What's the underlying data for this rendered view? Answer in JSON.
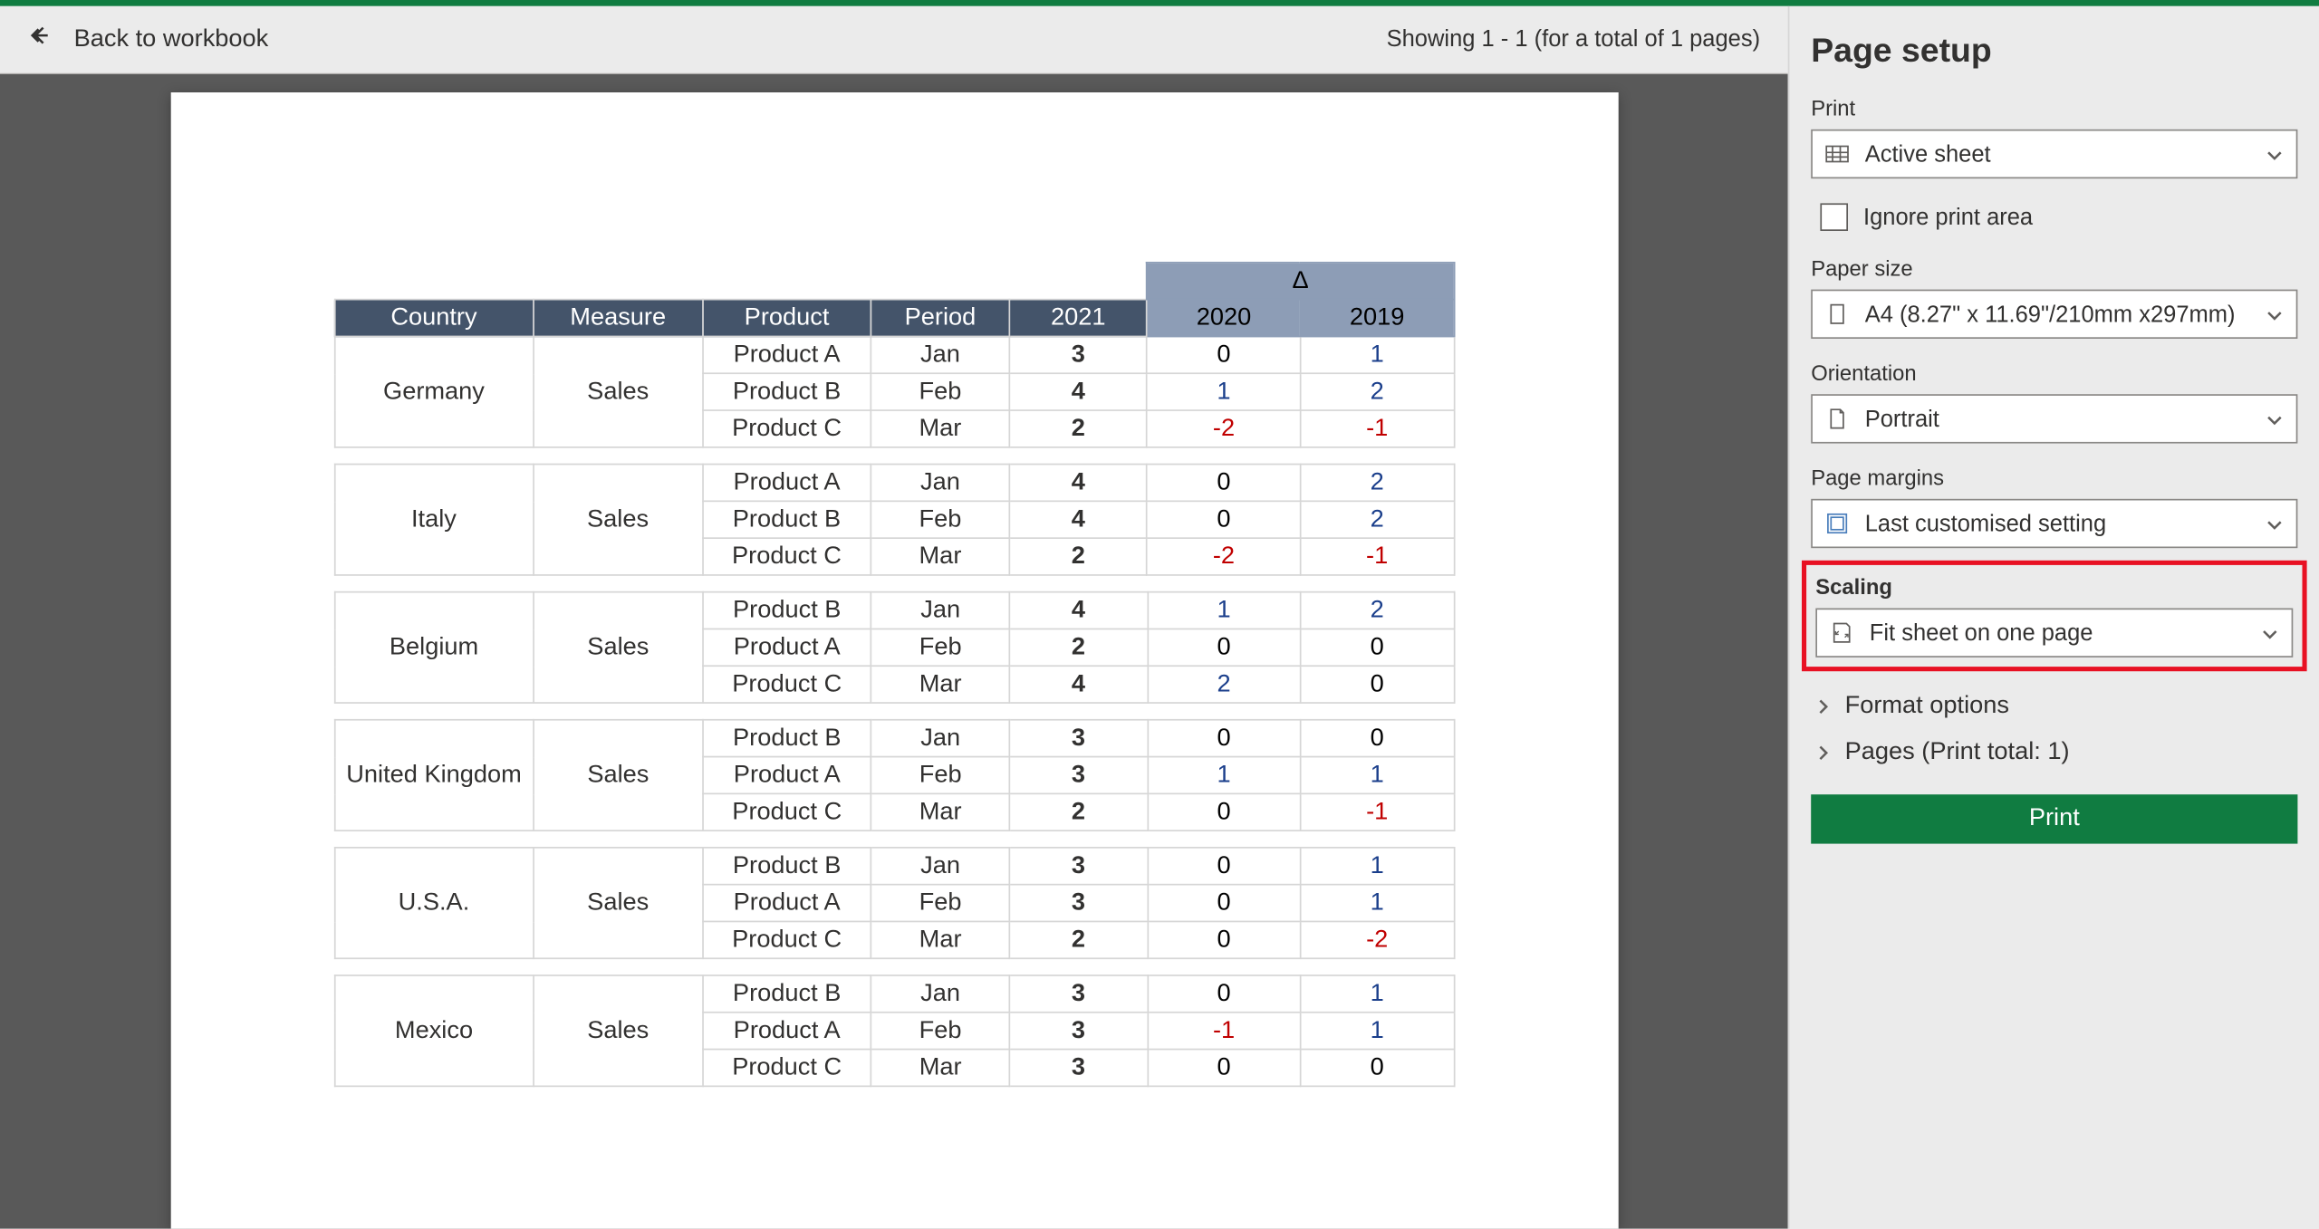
{
  "header": {
    "back_label": "Back to workbook",
    "showing": "Showing 1 - 1 (for a total of 1 pages)"
  },
  "table": {
    "delta_symbol": "Δ",
    "columns": [
      "Country",
      "Measure",
      "Product",
      "Period",
      "2021",
      "2020",
      "2019"
    ],
    "blocks": [
      {
        "country": "Germany",
        "measure": "Sales",
        "rows": [
          {
            "product": "Product A",
            "period": "Jan",
            "v2021": "3",
            "d2020": "0",
            "d2019": "1"
          },
          {
            "product": "Product B",
            "period": "Feb",
            "v2021": "4",
            "d2020": "1",
            "d2019": "2"
          },
          {
            "product": "Product C",
            "period": "Mar",
            "v2021": "2",
            "d2020": "-2",
            "d2019": "-1"
          }
        ]
      },
      {
        "country": "Italy",
        "measure": "Sales",
        "rows": [
          {
            "product": "Product A",
            "period": "Jan",
            "v2021": "4",
            "d2020": "0",
            "d2019": "2"
          },
          {
            "product": "Product B",
            "period": "Feb",
            "v2021": "4",
            "d2020": "0",
            "d2019": "2"
          },
          {
            "product": "Product C",
            "period": "Mar",
            "v2021": "2",
            "d2020": "-2",
            "d2019": "-1"
          }
        ]
      },
      {
        "country": "Belgium",
        "measure": "Sales",
        "rows": [
          {
            "product": "Product B",
            "period": "Jan",
            "v2021": "4",
            "d2020": "1",
            "d2019": "2"
          },
          {
            "product": "Product A",
            "period": "Feb",
            "v2021": "2",
            "d2020": "0",
            "d2019": "0"
          },
          {
            "product": "Product C",
            "period": "Mar",
            "v2021": "4",
            "d2020": "2",
            "d2019": "0"
          }
        ]
      },
      {
        "country": "United Kingdom",
        "measure": "Sales",
        "rows": [
          {
            "product": "Product B",
            "period": "Jan",
            "v2021": "3",
            "d2020": "0",
            "d2019": "0"
          },
          {
            "product": "Product A",
            "period": "Feb",
            "v2021": "3",
            "d2020": "1",
            "d2019": "1"
          },
          {
            "product": "Product C",
            "period": "Mar",
            "v2021": "2",
            "d2020": "0",
            "d2019": "-1"
          }
        ]
      },
      {
        "country": "U.S.A.",
        "measure": "Sales",
        "rows": [
          {
            "product": "Product B",
            "period": "Jan",
            "v2021": "3",
            "d2020": "0",
            "d2019": "1"
          },
          {
            "product": "Product A",
            "period": "Feb",
            "v2021": "3",
            "d2020": "0",
            "d2019": "1"
          },
          {
            "product": "Product C",
            "period": "Mar",
            "v2021": "2",
            "d2020": "0",
            "d2019": "-2"
          }
        ]
      },
      {
        "country": "Mexico",
        "measure": "Sales",
        "rows": [
          {
            "product": "Product B",
            "period": "Jan",
            "v2021": "3",
            "d2020": "0",
            "d2019": "1"
          },
          {
            "product": "Product A",
            "period": "Feb",
            "v2021": "3",
            "d2020": "-1",
            "d2019": "1"
          },
          {
            "product": "Product C",
            "period": "Mar",
            "v2021": "3",
            "d2020": "0",
            "d2019": "0"
          }
        ]
      }
    ]
  },
  "panel": {
    "title": "Page setup",
    "print_label": "Print",
    "print_select": "Active sheet",
    "ignore_print_area": "Ignore print area",
    "paper_label": "Paper size",
    "paper_value": "A4 (8.27\" x 11.69\"/210mm x297mm)",
    "orientation_label": "Orientation",
    "orientation_value": "Portrait",
    "margins_label": "Page margins",
    "margins_value": "Last customised setting",
    "scaling_label": "Scaling",
    "scaling_value": "Fit sheet on one page",
    "format_options": "Format options",
    "pages_label": "Pages (Print total: 1)",
    "print_button": "Print"
  }
}
